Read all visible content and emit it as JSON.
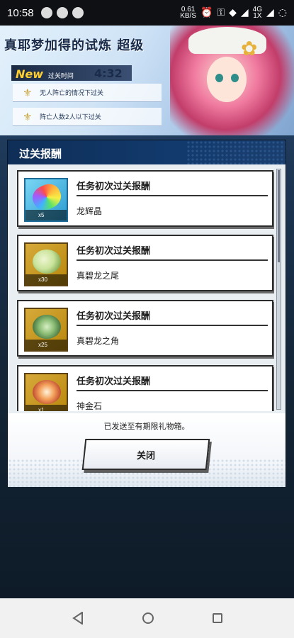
{
  "status_bar": {
    "time": "10:58",
    "speed_value": "0.61",
    "speed_unit": "KB/S",
    "network": "4G",
    "signal_sub": "1X"
  },
  "game": {
    "stage_title": "真耶梦加得的试炼 超级",
    "new_badge": "New",
    "time_label": "过关时间",
    "timer": "4:32",
    "conditions": [
      "无人阵亡的情况下过关",
      "阵亡人数2人以下过关"
    ]
  },
  "dialog": {
    "title": "过关报酬",
    "rewards": [
      {
        "title": "任务初次过关报酬",
        "item": "龙辉晶",
        "qty": "x5",
        "icon": "rainbow-crystal-icon"
      },
      {
        "title": "任务初次过关报酬",
        "item": "真碧龙之尾",
        "qty": "x30",
        "icon": "dragon-tail-icon"
      },
      {
        "title": "任务初次过关报酬",
        "item": "真碧龙之角",
        "qty": "x25",
        "icon": "dragon-horn-icon"
      },
      {
        "title": "任务初次过关报酬",
        "item": "神金石",
        "qty": "x1",
        "icon": "divine-gold-stone-icon"
      }
    ],
    "footer_message": "已发送至有期限礼物箱。",
    "close_label": "关闭"
  }
}
